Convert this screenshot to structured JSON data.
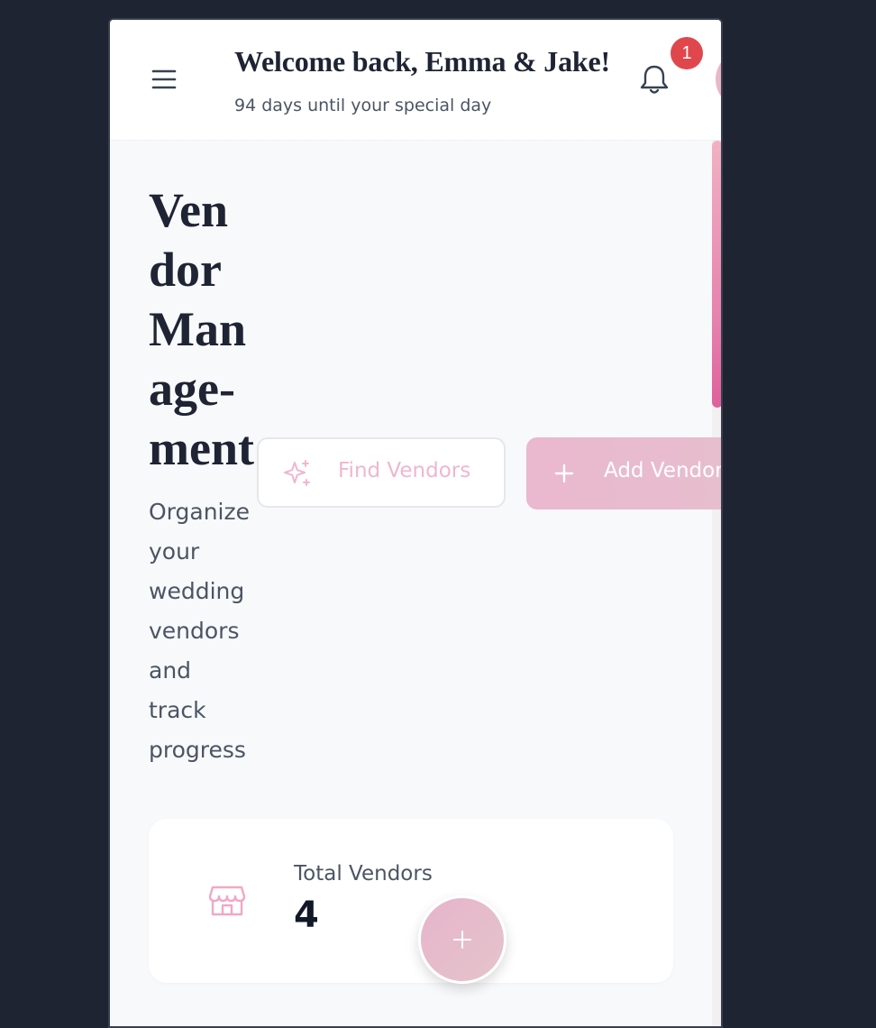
{
  "header": {
    "welcome": "Welcome back, Emma & Jake!",
    "countdown": "94 days until your special day",
    "notification_count": "1",
    "icons": {
      "menu": "hamburger-menu-icon",
      "bell": "bell-icon"
    }
  },
  "page": {
    "title_lines": [
      "Ven",
      "dor",
      "Man",
      "age-",
      "ment"
    ],
    "subtitle_lines": [
      "Organize",
      "your",
      "wedding",
      "vendors",
      "and",
      "track",
      "progress"
    ]
  },
  "actions": {
    "find_vendors": {
      "label": "Find Vendors",
      "icon": "sparkles-icon"
    },
    "add_vendor": {
      "label": "Add Vendor",
      "icon": "plus-icon"
    }
  },
  "stats": {
    "total_vendors": {
      "label": "Total Vendors",
      "value": "4",
      "icon": "store-icon"
    }
  },
  "fab": {
    "icon": "plus-icon"
  },
  "colors": {
    "background": "#1f2433",
    "accent_pink": "#e67fad",
    "badge_red": "#e0474c",
    "text_dark": "#1e2433",
    "text_muted": "#4b5563"
  }
}
